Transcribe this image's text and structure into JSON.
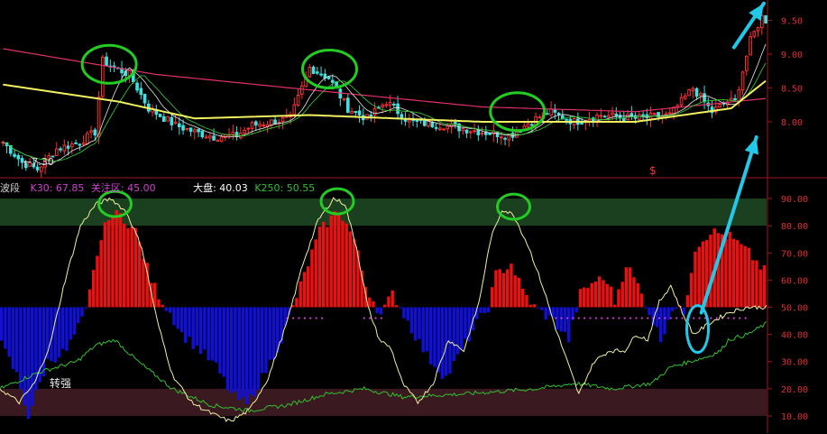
{
  "chart_data": [
    {
      "type": "candlestick",
      "panel": "price",
      "axis": {
        "side": "right",
        "ylim": [
          7.2,
          9.8
        ],
        "ticks": [
          8.0,
          8.5,
          9.0,
          9.5
        ],
        "tick_labels": [
          "8.00",
          "8.50",
          "9.00",
          "9.50"
        ]
      },
      "low_annotation": "←7.30",
      "marker_label": "$",
      "colors": {
        "up": "#ff3030",
        "down": "#40e0e0",
        "ma_long": "#e0306a",
        "ma_yellow": "#f0f060",
        "ma_white": "#e8e8e8",
        "ma_green": "#30c030"
      },
      "n_bars": 200,
      "close_path": [
        [
          0,
          7.7
        ],
        [
          10,
          7.4
        ],
        [
          18,
          7.3
        ],
        [
          28,
          7.6
        ],
        [
          40,
          7.7
        ],
        [
          48,
          7.85
        ],
        [
          52,
          8.9
        ],
        [
          58,
          8.8
        ],
        [
          66,
          8.7
        ],
        [
          76,
          8.2
        ],
        [
          90,
          7.95
        ],
        [
          100,
          7.85
        ],
        [
          110,
          7.78
        ],
        [
          122,
          7.8
        ],
        [
          130,
          7.95
        ],
        [
          140,
          8.0
        ],
        [
          150,
          8.05
        ],
        [
          160,
          8.8
        ],
        [
          170,
          8.65
        ],
        [
          180,
          8.2
        ],
        [
          190,
          8.05
        ],
        [
          200,
          8.3
        ],
        [
          212,
          8.0
        ],
        [
          230,
          7.95
        ],
        [
          250,
          7.85
        ],
        [
          265,
          7.8
        ],
        [
          275,
          8.0
        ],
        [
          285,
          8.15
        ],
        [
          298,
          8.0
        ],
        [
          312,
          8.1
        ],
        [
          330,
          8.05
        ],
        [
          348,
          8.1
        ],
        [
          360,
          8.5
        ],
        [
          370,
          8.15
        ],
        [
          378,
          8.3
        ],
        [
          382,
          8.3
        ],
        [
          390,
          9.2
        ],
        [
          396,
          9.55
        ],
        [
          400,
          9.45
        ]
      ],
      "ma_long_path": [
        [
          0,
          9.08
        ],
        [
          80,
          8.7
        ],
        [
          150,
          8.5
        ],
        [
          250,
          8.22
        ],
        [
          330,
          8.15
        ],
        [
          400,
          8.35
        ]
      ],
      "ma_yellow_path": [
        [
          0,
          8.55
        ],
        [
          60,
          8.3
        ],
        [
          100,
          8.05
        ],
        [
          160,
          8.1
        ],
        [
          250,
          8.0
        ],
        [
          330,
          8.0
        ],
        [
          380,
          8.2
        ],
        [
          400,
          8.65
        ]
      ],
      "highlights": [
        {
          "shape": "ellipse",
          "color": "#22cc22",
          "at": [
            57,
            8.85
          ]
        },
        {
          "shape": "ellipse",
          "color": "#22cc22",
          "at": [
            172,
            8.78
          ]
        },
        {
          "shape": "ellipse",
          "color": "#22cc22",
          "at": [
            270,
            8.15
          ]
        }
      ],
      "arrows": [
        {
          "color": "#22c8e8",
          "from": [
            383,
            9.1
          ],
          "to": [
            392,
            9.75
          ]
        }
      ]
    },
    {
      "type": "oscillator",
      "panel": "indicator",
      "axis": {
        "side": "right",
        "ylim": [
          7,
          95
        ],
        "ticks": [
          10,
          20,
          30,
          40,
          50,
          60,
          70,
          80,
          90
        ],
        "tick_labels": [
          "10.00",
          "20.00",
          "30.00",
          "40.00",
          "50.00",
          "60.00",
          "70.00",
          "80.00",
          "90.00"
        ]
      },
      "zero_line": 50,
      "bands": [
        {
          "from": 80,
          "to": 90,
          "color": "#1a4020"
        },
        {
          "from": 10,
          "to": 20,
          "color": "#3a1a20"
        }
      ],
      "title_parts": [
        {
          "text": "波段",
          "color": "#cfcfcf"
        },
        {
          "text": "K30: 67.85",
          "color": "#d040d0"
        },
        {
          "text": "关注区: 45.00",
          "color": "#d040d0"
        },
        {
          "text": "大盘: 40.03",
          "color": "#ffffff"
        },
        {
          "text": "K250: 50.55",
          "color": "#30c030"
        }
      ],
      "annotation": "转强",
      "colors": {
        "above": "#ee1010",
        "below": "#1010d8",
        "k30_line": "#f0f0a0",
        "k250_line": "#30c030",
        "focus_dots": "#e040e0"
      },
      "histogram_path": [
        [
          0,
          36
        ],
        [
          8,
          25
        ],
        [
          14,
          10
        ],
        [
          18,
          18
        ],
        [
          24,
          30
        ],
        [
          34,
          34
        ],
        [
          44,
          48
        ],
        [
          50,
          70
        ],
        [
          56,
          84
        ],
        [
          62,
          84
        ],
        [
          70,
          78
        ],
        [
          78,
          60
        ],
        [
          84,
          52
        ],
        [
          88,
          48
        ],
        [
          94,
          40
        ],
        [
          104,
          34
        ],
        [
          112,
          28
        ],
        [
          120,
          18
        ],
        [
          128,
          14
        ],
        [
          136,
          24
        ],
        [
          146,
          38
        ],
        [
          152,
          50
        ],
        [
          158,
          62
        ],
        [
          166,
          78
        ],
        [
          176,
          86
        ],
        [
          184,
          75
        ],
        [
          190,
          58
        ],
        [
          198,
          47
        ],
        [
          204,
          55
        ],
        [
          208,
          50
        ],
        [
          214,
          42
        ],
        [
          222,
          32
        ],
        [
          232,
          24
        ],
        [
          240,
          34
        ],
        [
          248,
          44
        ],
        [
          254,
          50
        ],
        [
          258,
          62
        ],
        [
          266,
          66
        ],
        [
          272,
          56
        ],
        [
          278,
          50
        ],
        [
          288,
          45
        ],
        [
          296,
          38
        ],
        [
          302,
          55
        ],
        [
          310,
          60
        ],
        [
          316,
          60
        ],
        [
          320,
          52
        ],
        [
          326,
          66
        ],
        [
          332,
          58
        ],
        [
          338,
          48
        ],
        [
          344,
          38
        ],
        [
          350,
          50
        ],
        [
          356,
          48
        ],
        [
          362,
          72
        ],
        [
          370,
          78
        ],
        [
          380,
          76
        ],
        [
          390,
          70
        ],
        [
          396,
          65
        ],
        [
          400,
          62
        ]
      ],
      "k30_path": [
        [
          0,
          20
        ],
        [
          10,
          15
        ],
        [
          18,
          22
        ],
        [
          26,
          36
        ],
        [
          34,
          60
        ],
        [
          42,
          80
        ],
        [
          50,
          88
        ],
        [
          58,
          90
        ],
        [
          66,
          85
        ],
        [
          74,
          72
        ],
        [
          82,
          45
        ],
        [
          90,
          25
        ],
        [
          100,
          15
        ],
        [
          110,
          11
        ],
        [
          120,
          8
        ],
        [
          130,
          12
        ],
        [
          140,
          24
        ],
        [
          150,
          45
        ],
        [
          158,
          66
        ],
        [
          166,
          82
        ],
        [
          174,
          90
        ],
        [
          180,
          88
        ],
        [
          186,
          72
        ],
        [
          192,
          50
        ],
        [
          198,
          38
        ],
        [
          204,
          35
        ],
        [
          210,
          22
        ],
        [
          218,
          15
        ],
        [
          226,
          22
        ],
        [
          234,
          38
        ],
        [
          242,
          34
        ],
        [
          250,
          52
        ],
        [
          256,
          75
        ],
        [
          262,
          86
        ],
        [
          268,
          84
        ],
        [
          276,
          72
        ],
        [
          284,
          56
        ],
        [
          290,
          42
        ],
        [
          296,
          30
        ],
        [
          302,
          18
        ],
        [
          310,
          30
        ],
        [
          318,
          34
        ],
        [
          326,
          34
        ],
        [
          332,
          40
        ],
        [
          338,
          38
        ],
        [
          344,
          52
        ],
        [
          350,
          58
        ],
        [
          356,
          48
        ],
        [
          362,
          40
        ],
        [
          370,
          44
        ],
        [
          380,
          48
        ],
        [
          390,
          50
        ],
        [
          400,
          50
        ]
      ],
      "k250_path": [
        [
          0,
          20
        ],
        [
          20,
          26
        ],
        [
          40,
          30
        ],
        [
          50,
          36
        ],
        [
          60,
          38
        ],
        [
          72,
          30
        ],
        [
          90,
          20
        ],
        [
          110,
          14
        ],
        [
          130,
          12
        ],
        [
          150,
          14
        ],
        [
          170,
          18
        ],
        [
          190,
          20
        ],
        [
          210,
          17
        ],
        [
          240,
          18
        ],
        [
          260,
          19
        ],
        [
          280,
          20
        ],
        [
          300,
          22
        ],
        [
          320,
          20
        ],
        [
          340,
          22
        ],
        [
          350,
          28
        ],
        [
          360,
          30
        ],
        [
          370,
          32
        ],
        [
          376,
          34
        ],
        [
          380,
          38
        ],
        [
          390,
          40
        ],
        [
          400,
          44
        ]
      ],
      "focus_dot_ranges": [
        [
          150,
          168
        ],
        [
          190,
          200
        ],
        [
          290,
          390
        ]
      ],
      "highlights": [
        {
          "shape": "ellipse",
          "color": "#22cc22",
          "at": [
            60,
            88
          ]
        },
        {
          "shape": "ellipse",
          "color": "#22cc22",
          "at": [
            176,
            89
          ]
        },
        {
          "shape": "ellipse",
          "color": "#22cc22",
          "at": [
            268,
            87
          ]
        },
        {
          "shape": "ellipse",
          "color": "#22c8e8",
          "at": [
            364,
            42
          ]
        }
      ],
      "arrows": [
        {
          "color": "#22c8e8",
          "from": [
            366,
            48
          ],
          "to": [
            390,
            96
          ]
        }
      ]
    }
  ]
}
